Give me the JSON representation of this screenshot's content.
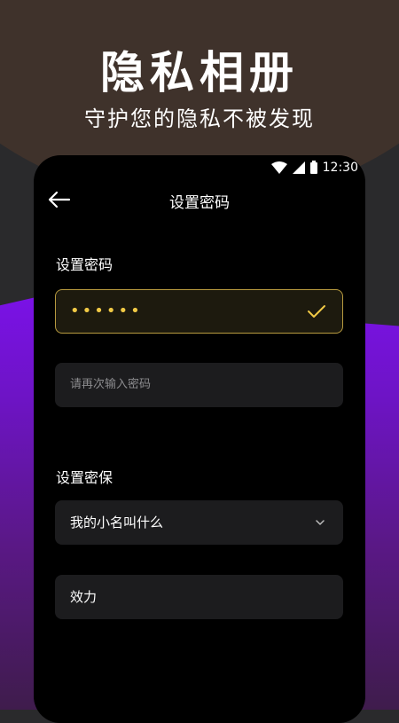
{
  "promo": {
    "title": "隐私相册",
    "subtitle": "守护您的隐私不被发现"
  },
  "status_bar": {
    "time": "12:30",
    "icons": [
      "wifi-icon",
      "signal-icon",
      "battery-icon"
    ]
  },
  "header": {
    "title": "设置密码",
    "back_icon": "arrow-left-icon"
  },
  "password_section": {
    "label": "设置密码",
    "password_value": "••••••",
    "confirm_placeholder": "请再次输入密码"
  },
  "security_section": {
    "label": "设置密保",
    "question_selected": "我的小名叫什么",
    "answer_value": "效力"
  },
  "colors": {
    "accent_gold": "#f0c945",
    "field_bg": "#1c1c1e",
    "purple": "#7a12e6"
  }
}
